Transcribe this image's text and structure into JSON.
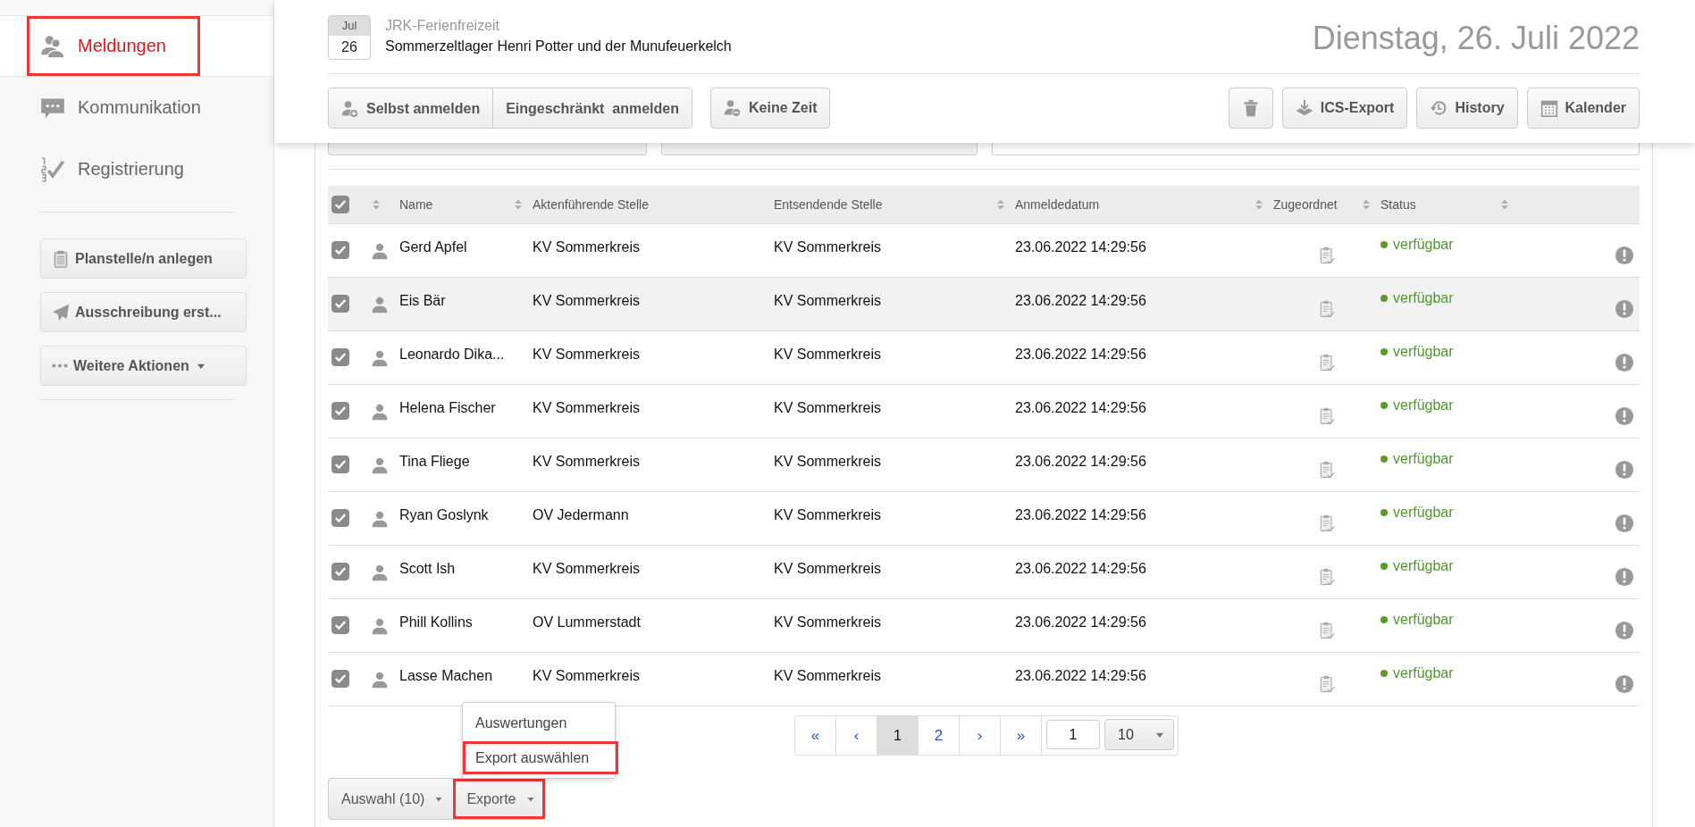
{
  "sidebar": {
    "nav": [
      {
        "label": "Meldungen",
        "selected": true,
        "annotated": true
      },
      {
        "label": "Kommunikation",
        "selected": false,
        "annotated": false
      },
      {
        "label": "Registrierung",
        "selected": false,
        "annotated": false
      }
    ],
    "actions": [
      {
        "label": "Planstelle/n anlegen",
        "dropdown": false
      },
      {
        "label": "Ausschreibung erst...",
        "dropdown": false
      },
      {
        "label": "Weitere Aktionen",
        "dropdown": true
      }
    ]
  },
  "event": {
    "month": "Jul",
    "day": "26",
    "category": "JRK-Ferienfreizeit",
    "title": "Sommerzeltlager Henri Potter und der Munufeuerkelch",
    "date": "Dienstag, 26. Juli 2022"
  },
  "toolbar": {
    "signup_group": [
      {
        "kind": "self",
        "label": "Selbst anmelden"
      },
      {
        "kind": "restricted",
        "label": "Eingeschränkt  anmelden"
      }
    ],
    "left": [
      {
        "kind": "absent",
        "label": "Keine Zeit"
      }
    ],
    "right": [
      {
        "kind": "delete"
      },
      {
        "kind": "export",
        "label": "ICS-Export"
      },
      {
        "kind": "history",
        "label": "History"
      },
      {
        "kind": "calendar",
        "label": "Kalender"
      }
    ]
  },
  "table": {
    "all_checked": true,
    "columns": [
      {
        "kind": "icon",
        "sortable": true
      },
      {
        "kind": "text",
        "label": "Name",
        "sortable": true
      },
      {
        "kind": "text",
        "label": "Aktenführende Stelle",
        "sortable": false
      },
      {
        "kind": "text",
        "label": "Entsendende Stelle",
        "sortable": true
      },
      {
        "kind": "text",
        "label": "Anmeldedatum",
        "sortable": true
      },
      {
        "kind": "text",
        "label": "Zugeordnet",
        "sortable": true
      },
      {
        "kind": "text",
        "label": "Status",
        "sortable": true
      }
    ],
    "rows": [
      {
        "checked": true,
        "hovered": false,
        "name": "Gerd Apfel",
        "office": "KV Sommerkreis",
        "sender": "KV Sommerkreis",
        "date": "23.06.2022 14:29:56",
        "status": "verfügbar"
      },
      {
        "checked": true,
        "hovered": true,
        "name": "Eis Bär",
        "office": "KV Sommerkreis",
        "sender": "KV Sommerkreis",
        "date": "23.06.2022 14:29:56",
        "status": "verfügbar"
      },
      {
        "checked": true,
        "hovered": false,
        "name": "Leonardo Dika...",
        "office": "KV Sommerkreis",
        "sender": "KV Sommerkreis",
        "date": "23.06.2022 14:29:56",
        "status": "verfügbar"
      },
      {
        "checked": true,
        "hovered": false,
        "name": "Helena Fischer",
        "office": "KV Sommerkreis",
        "sender": "KV Sommerkreis",
        "date": "23.06.2022 14:29:56",
        "status": "verfügbar"
      },
      {
        "checked": true,
        "hovered": false,
        "name": "Tina Fliege",
        "office": "KV Sommerkreis",
        "sender": "KV Sommerkreis",
        "date": "23.06.2022 14:29:56",
        "status": "verfügbar"
      },
      {
        "checked": true,
        "hovered": false,
        "name": "Ryan Goslynk",
        "office": "OV Jedermann",
        "sender": "KV Sommerkreis",
        "date": "23.06.2022 14:29:56",
        "status": "verfügbar"
      },
      {
        "checked": true,
        "hovered": false,
        "name": "Scott Ish",
        "office": "KV Sommerkreis",
        "sender": "KV Sommerkreis",
        "date": "23.06.2022 14:29:56",
        "status": "verfügbar"
      },
      {
        "checked": true,
        "hovered": false,
        "name": "Phill Kollins",
        "office": "OV Lummerstadt",
        "sender": "KV Sommerkreis",
        "date": "23.06.2022 14:29:56",
        "status": "verfügbar"
      },
      {
        "checked": true,
        "hovered": false,
        "name": "Lasse Machen",
        "office": "KV Sommerkreis",
        "sender": "KV Sommerkreis",
        "date": "23.06.2022 14:29:56",
        "status": "verfügbar"
      }
    ]
  },
  "pagination": {
    "pages": [
      {
        "label": "«",
        "selected": false
      },
      {
        "label": "‹",
        "selected": false
      },
      {
        "label": "1",
        "selected": true
      },
      {
        "label": "2",
        "selected": false
      },
      {
        "label": "›",
        "selected": false
      },
      {
        "label": "»",
        "selected": false
      }
    ],
    "page_input": "1",
    "page_size": "10"
  },
  "footer": {
    "selection": {
      "label": "Auswahl (10)",
      "annotated": false
    },
    "exports": {
      "label": "Exporte",
      "annotated": true
    },
    "menu": [
      {
        "label": "Auswertungen",
        "annotated": false
      },
      {
        "label": "Export auswählen",
        "annotated": true
      }
    ]
  }
}
